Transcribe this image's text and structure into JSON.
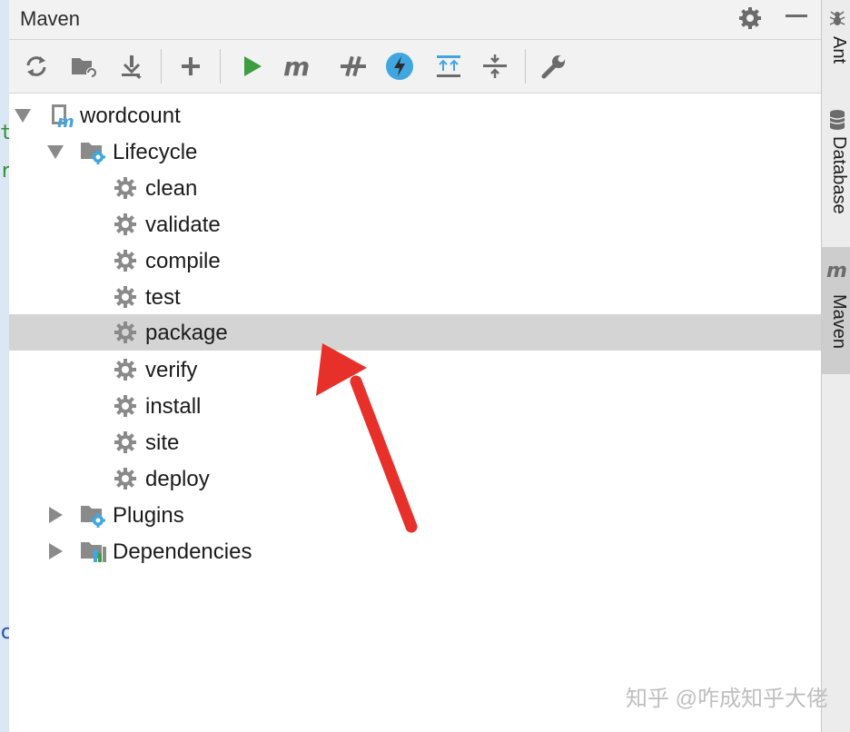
{
  "window": {
    "title": "Maven"
  },
  "left_edge_fragments": [
    "t",
    "r",
    "c"
  ],
  "toolbar": {
    "buttons": [
      {
        "name": "reload-all",
        "icon": "refresh-icon"
      },
      {
        "name": "generate-sources",
        "icon": "folder-refresh-icon"
      },
      {
        "name": "download-sources",
        "icon": "download-icon"
      },
      {
        "name": "add-project",
        "icon": "plus-icon"
      },
      {
        "name": "run",
        "icon": "play-icon"
      },
      {
        "name": "execute-goal",
        "icon": "maven-m-icon"
      },
      {
        "name": "toggle-offline",
        "icon": "offline-icon"
      },
      {
        "name": "skip-tests",
        "icon": "lightning-icon"
      },
      {
        "name": "show-dependencies",
        "icon": "expand-icon"
      },
      {
        "name": "collapse-all",
        "icon": "collapse-icon"
      },
      {
        "name": "settings",
        "icon": "wrench-icon"
      }
    ]
  },
  "tree": {
    "project": "wordcount",
    "lifecycle": {
      "label": "Lifecycle",
      "goals": [
        "clean",
        "validate",
        "compile",
        "test",
        "package",
        "verify",
        "install",
        "site",
        "deploy"
      ],
      "selected": "package"
    },
    "plugins": "Plugins",
    "dependencies": "Dependencies"
  },
  "right_strip": {
    "tabs": [
      {
        "label": "Ant",
        "active": false
      },
      {
        "label": "Database",
        "active": false
      },
      {
        "label": "Maven",
        "active": true
      }
    ]
  },
  "watermark": "知乎 @咋成知乎大佬",
  "colors": {
    "run_green": "#3c9e41",
    "accent_blue": "#40a6e0",
    "arrow_red": "#e8302a",
    "selection": "#d4d4d4"
  }
}
